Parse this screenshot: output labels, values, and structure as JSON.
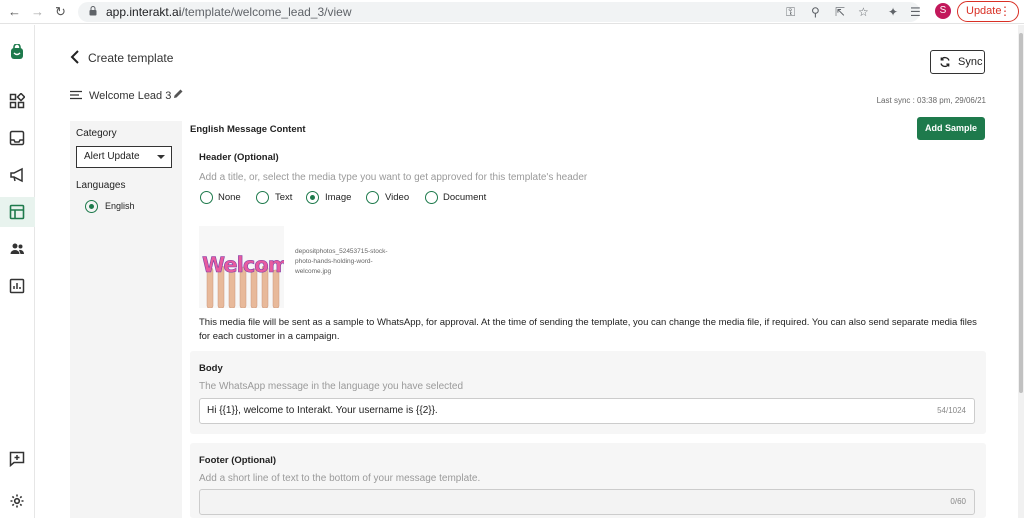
{
  "browser": {
    "url_domain": "app.interakt.ai",
    "url_path": "/template/welcome_lead_3/view",
    "profile_initial": "S",
    "update_label": "Update"
  },
  "header": {
    "back_title": "Create template",
    "template_name": "Welcome Lead 3",
    "sync_label": "Sync",
    "last_sync": "Last sync : 03:38 pm, 29/06/21"
  },
  "left_panel": {
    "category_label": "Category",
    "category_value": "Alert Update",
    "languages_label": "Languages",
    "language": "English"
  },
  "main": {
    "title": "English Message Content",
    "add_sample_label": "Add Sample",
    "header_section": {
      "title": "Header (Optional)",
      "hint": "Add a title, or, select the media type you want to get approved for this template's header",
      "options": [
        "None",
        "Text",
        "Image",
        "Video",
        "Document"
      ],
      "selected": "Image",
      "image_word": "Welcome",
      "file_name": "depositphotos_52453715-stock-photo-hands-holding-word-welcome.jpg",
      "note": "This media file will be sent as a sample to WhatsApp, for approval. At the time of sending the template, you can change the media file, if required. You can also send separate media files for each customer in a campaign."
    },
    "body_section": {
      "title": "Body",
      "hint": "The WhatsApp message in the language you have selected",
      "value": "Hi {{1}}, welcome to Interakt. Your username is {{2}}.",
      "counter": "54/1024"
    },
    "footer_section": {
      "title": "Footer (Optional)",
      "hint": "Add a short line of text to the bottom of your message template.",
      "value": "",
      "counter": "0/60"
    }
  },
  "colors": {
    "brand_green": "#1e7a4c",
    "update_red": "#d93025"
  }
}
